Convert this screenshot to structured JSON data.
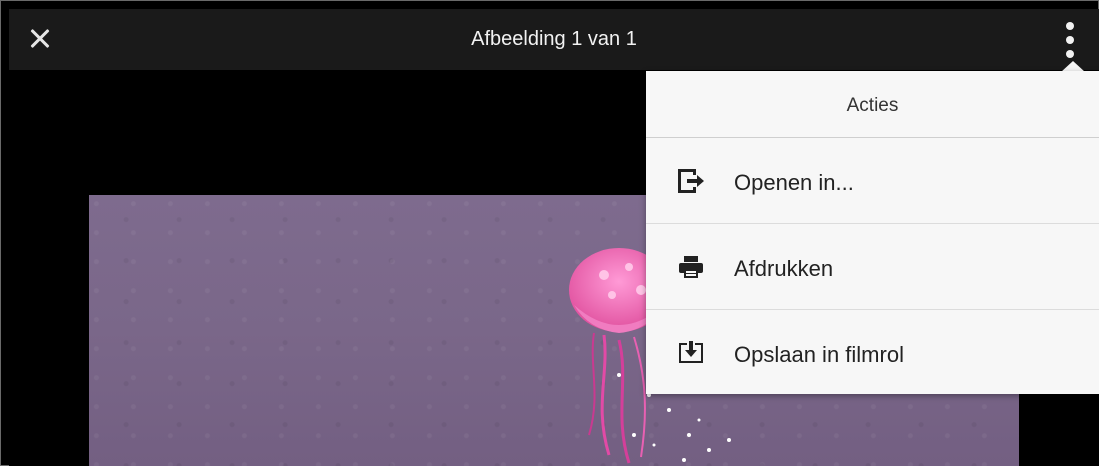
{
  "header": {
    "title": "Afbeelding 1 van 1",
    "close_icon": "close-icon",
    "more_icon": "more-vertical-icon"
  },
  "popover": {
    "title": "Acties",
    "items": [
      {
        "label": "Openen in...",
        "icon": "open-in-icon"
      },
      {
        "label": "Afdrukken",
        "icon": "printer-icon"
      },
      {
        "label": "Opslaan in filmrol",
        "icon": "save-to-camera-roll-icon"
      }
    ]
  },
  "colors": {
    "topbar": "#1a1a1a",
    "popover_bg": "#f7f7f7",
    "photo_bg": "#7a6789"
  }
}
